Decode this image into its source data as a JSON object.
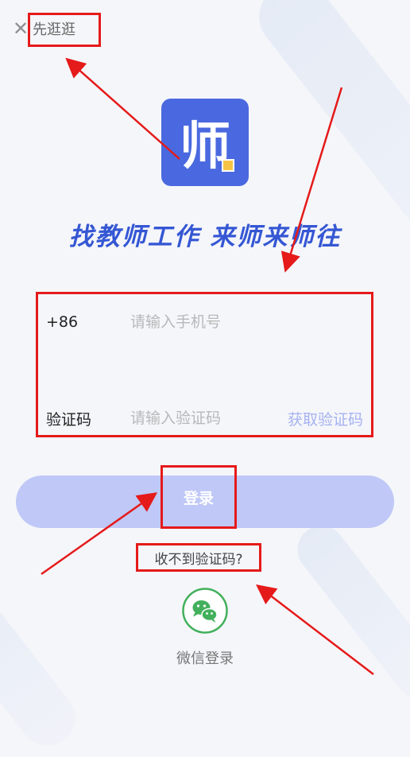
{
  "header": {
    "close_icon": "close-icon",
    "skip_label": "先逛逛"
  },
  "brand": {
    "logo_glyph": "师",
    "logo_color": "#4a69e0",
    "slogan": "找教师工作 来师来师往"
  },
  "login_form": {
    "phone": {
      "prefix": "+86",
      "placeholder": "请输入手机号",
      "value": ""
    },
    "code": {
      "label": "验证码",
      "placeholder": "请输入验证码",
      "value": "",
      "get_code_label": "获取验证码"
    },
    "submit_label": "登录",
    "help_link": "收不到验证码?"
  },
  "alt_login": {
    "wechat_icon": "wechat-icon",
    "wechat_label": "微信登录"
  },
  "colors": {
    "accent": "#4a69e0",
    "button_disabled": "#bfc8f6",
    "annotation": "#e51a1a",
    "wechat_green": "#43b05c"
  }
}
